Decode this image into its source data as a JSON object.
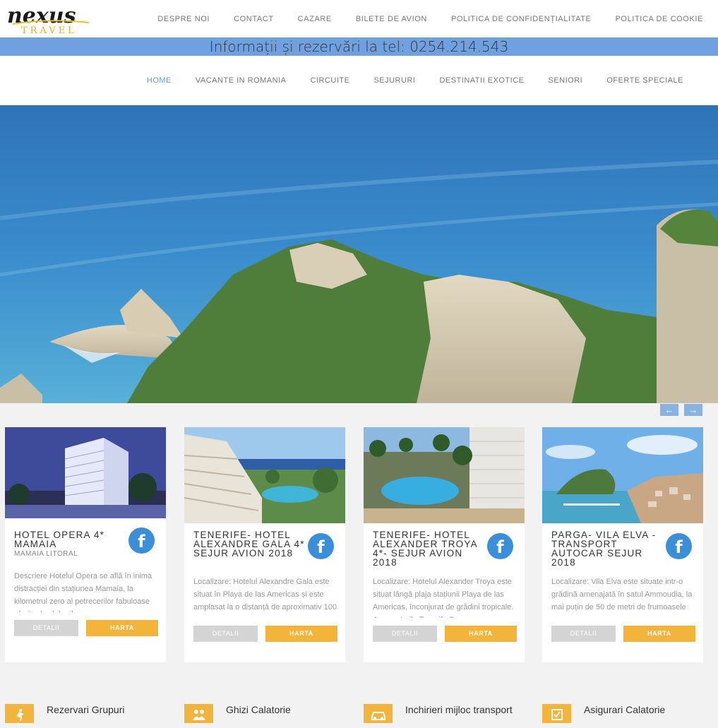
{
  "logo": {
    "text_top": "nexus",
    "text_bottom": "TRAVEL"
  },
  "top_nav": [
    "DESPRE NOI",
    "CONTACT",
    "CAZARE",
    "BILETE DE AVION",
    "POLITICA DE CONFIDENȚIALITATE",
    "POLITICA DE COOKIE"
  ],
  "info": "Informații și rezervări la tel: 0254.214.543",
  "main_nav": [
    "HOME",
    "VACANTE IN ROMANIA",
    "CIRCUITE",
    "SEJURURI",
    "DESTINATII EXOTICE",
    "SENIORI",
    "OFERTE SPECIALE"
  ],
  "slider": {
    "prev": "←",
    "next": "→"
  },
  "cards": [
    {
      "title": "HOTEL OPERA 4* MAMAIA",
      "subtitle": "MAMAIA LITORAL",
      "desc": "Descriere Hotelul Opera se află în inima distracției din stațiunea Mamaia, la kilometrul zero al petrecerilor fabuloase oferite de cluburile",
      "details": "DETALII",
      "map": "HARTA",
      "fb": "f"
    },
    {
      "title": "TENERIFE- HOTEL ALEXANDRE GALA 4* SEJUR AVION 2018",
      "subtitle": "",
      "desc": "Localizare: Hotelul Alexandre Gala este situat în Playa de las Americas și este amplasat la o distanță de aproximativ 100",
      "details": "DETALII",
      "map": "HARTA",
      "fb": "f"
    },
    {
      "title": "TENERIFE- HOTEL ALEXANDER TROYA 4*- SEJUR AVION 2018",
      "subtitle": "",
      "desc": "Localizare: Hotelul Alexander Troya este situat lângă plaja stațiunii Playa de las Americas, înconjurat de grădini tropicale. Aeroporturile Tenerife Sur",
      "details": "DETALII",
      "map": "HARTA",
      "fb": "f"
    },
    {
      "title": "PARGA- VILA ELVA - TRANSPORT AUTOCAR SEJUR 2018",
      "subtitle": "",
      "desc": "Localizare: Vila Elva este situate intr-o grădină amenajată în satul Ammoudia, la mai puțin de 50 de metri de frumoasele",
      "details": "DETALII",
      "map": "HARTA",
      "fb": "f"
    }
  ],
  "services": [
    {
      "label": "Rezervari Grupuri",
      "icon": "person-walking-icon"
    },
    {
      "label": "Ghizi Calatorie",
      "icon": "group-icon"
    },
    {
      "label": "Inchirieri mijloc transport",
      "icon": "car-icon"
    },
    {
      "label": "Asigurari Calatorie",
      "icon": "checkbox-icon"
    }
  ],
  "colors": {
    "accent": "#f3b43c",
    "blue": "#6fa0df",
    "nav_active": "#6a9bd8",
    "facebook": "#3b8fd8"
  }
}
